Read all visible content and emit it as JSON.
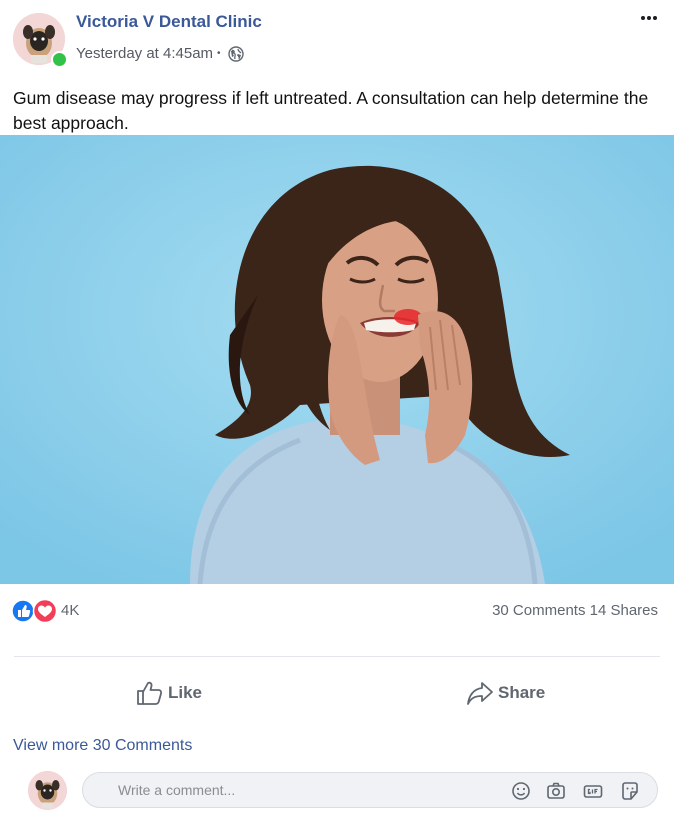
{
  "post": {
    "page_name": "Victoria V Dental Clinic",
    "timestamp": "Yesterday at 4:45am",
    "separator": "•",
    "privacy_icon": "globe-icon",
    "text": "Gum disease may progress if left untreated. A consultation can help determine the best approach.",
    "online": true
  },
  "stats": {
    "reaction_icons": [
      "like-reaction-icon",
      "love-reaction-icon"
    ],
    "reaction_count": "4K",
    "comments_shares": "30 Comments 14 Shares"
  },
  "actions": {
    "like_label": "Like",
    "share_label": "Share"
  },
  "comments": {
    "view_more": "View more 30 Comments",
    "placeholder": "Write a comment..."
  },
  "colors": {
    "page_name": "#3b5998",
    "online": "#31c24a",
    "like_blue": "#1877f2",
    "love_red": "#f33e58",
    "photo_background": "#8ed0ea"
  }
}
